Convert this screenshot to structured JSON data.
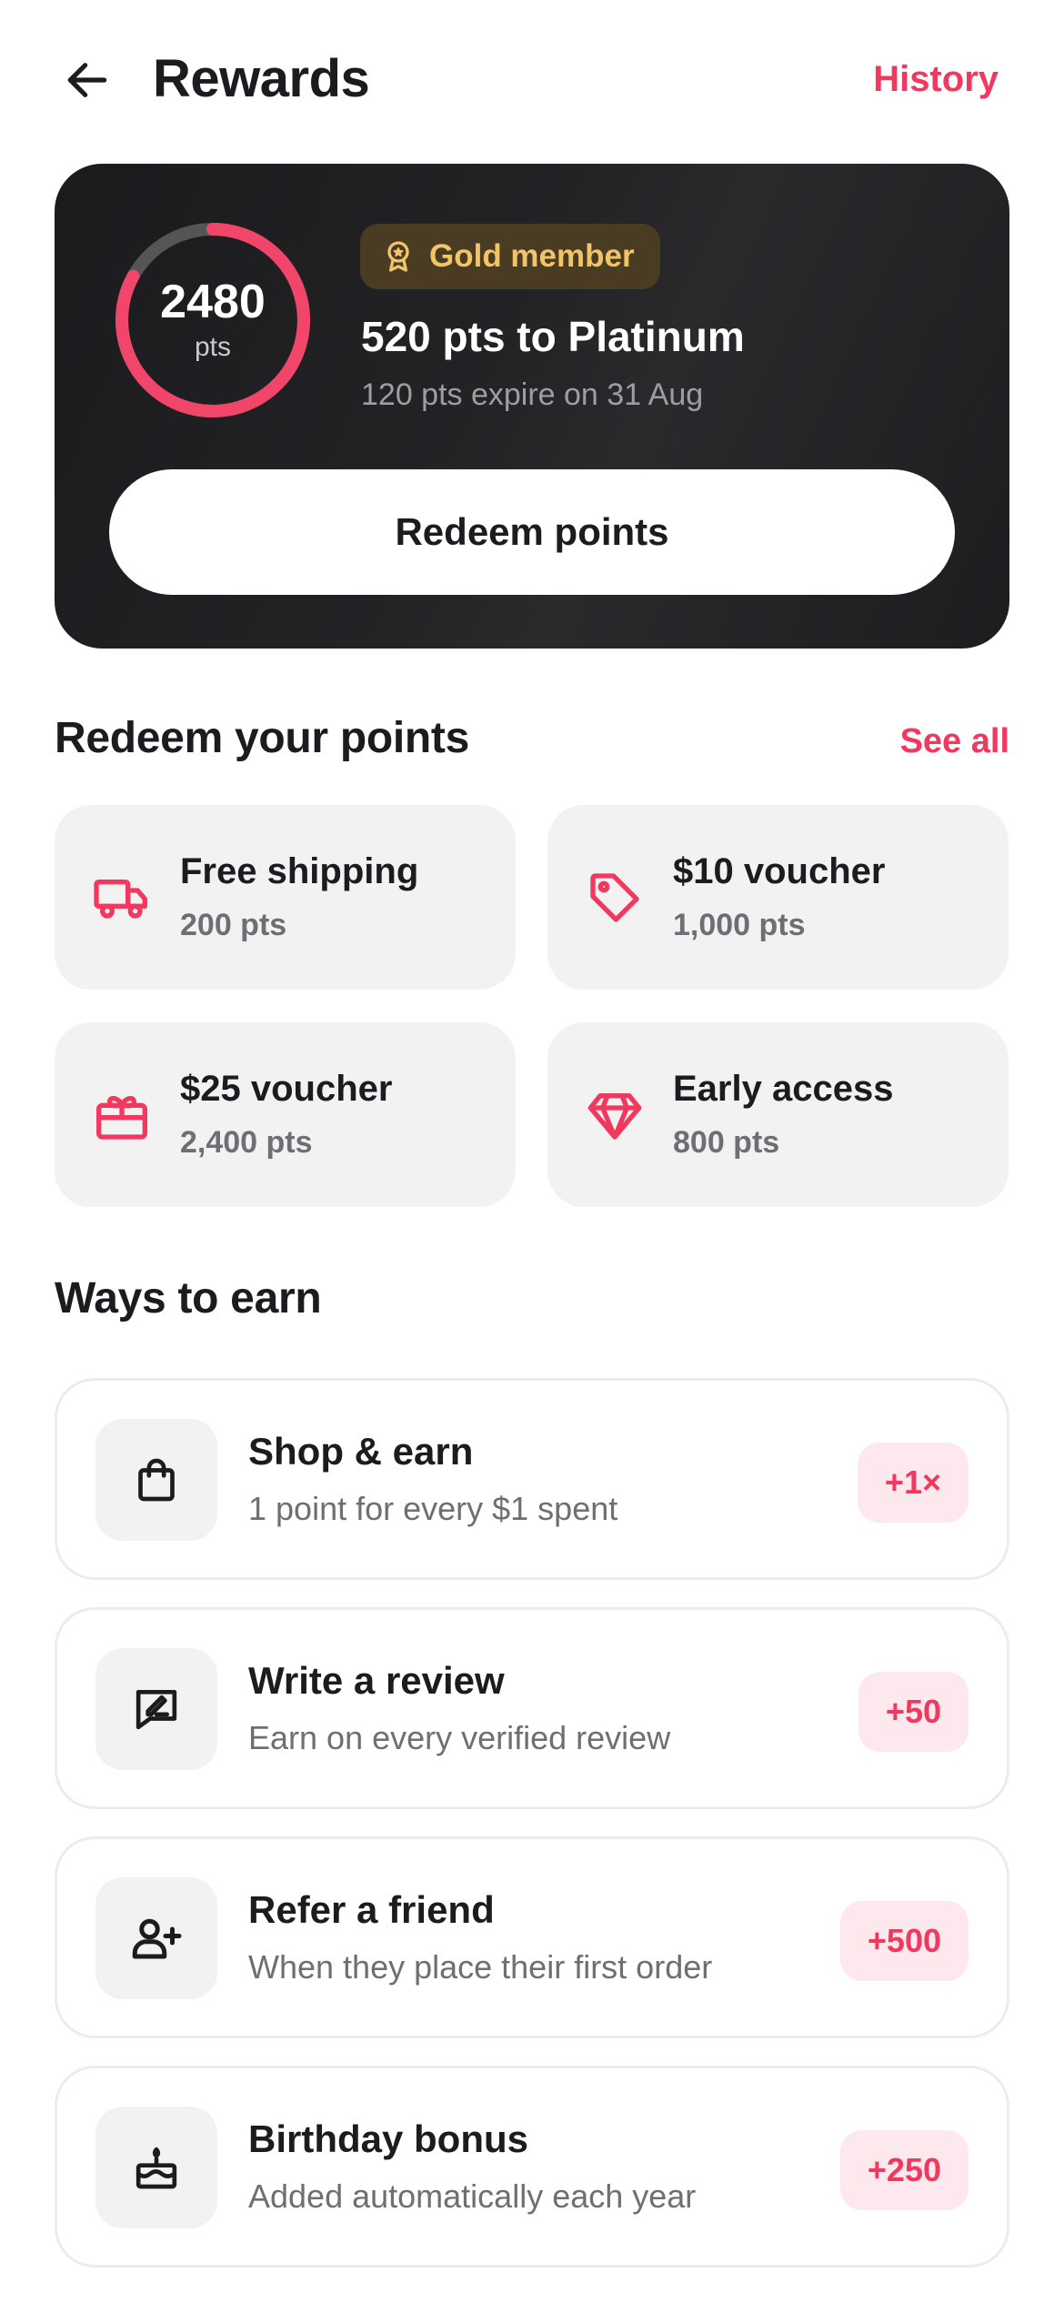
{
  "header": {
    "title": "Rewards",
    "history_label": "History",
    "back_icon": "arrow-left-icon"
  },
  "summary": {
    "points": "2480",
    "points_unit": "pts",
    "ring_progress": 0.83,
    "tier_label": "Gold member",
    "next_tier_text": "520 pts to Platinum",
    "expiry_text": "120 pts expire on 31 Aug",
    "redeem_label": "Redeem points"
  },
  "redeem_section": {
    "title": "Redeem your points",
    "see_all_label": "See all",
    "items": [
      {
        "name": "Free shipping",
        "cost": "200 pts",
        "icon": "truck-icon"
      },
      {
        "name": "$10 voucher",
        "cost": "1,000 pts",
        "icon": "tag-icon"
      },
      {
        "name": "$25 voucher",
        "cost": "2,400 pts",
        "icon": "gift-icon"
      },
      {
        "name": "Early access",
        "cost": "800 pts",
        "icon": "diamond-icon"
      }
    ]
  },
  "earn_section": {
    "title": "Ways to earn",
    "items": [
      {
        "title": "Shop & earn",
        "description": "1 point for every $1 spent",
        "badge": "+1×",
        "icon": "shopping-bag-icon"
      },
      {
        "title": "Write a review",
        "description": "Earn on every verified review",
        "badge": "+50",
        "icon": "review-icon"
      },
      {
        "title": "Refer a friend",
        "description": "When they place their first order",
        "badge": "+500",
        "icon": "add-user-icon"
      },
      {
        "title": "Birthday bonus",
        "description": "Added automatically each year",
        "badge": "+250",
        "icon": "birthday-cake-icon"
      }
    ]
  },
  "colors": {
    "accent": "#f2385e",
    "gold": "#f0c469",
    "card_dark": "#1d1d20"
  }
}
